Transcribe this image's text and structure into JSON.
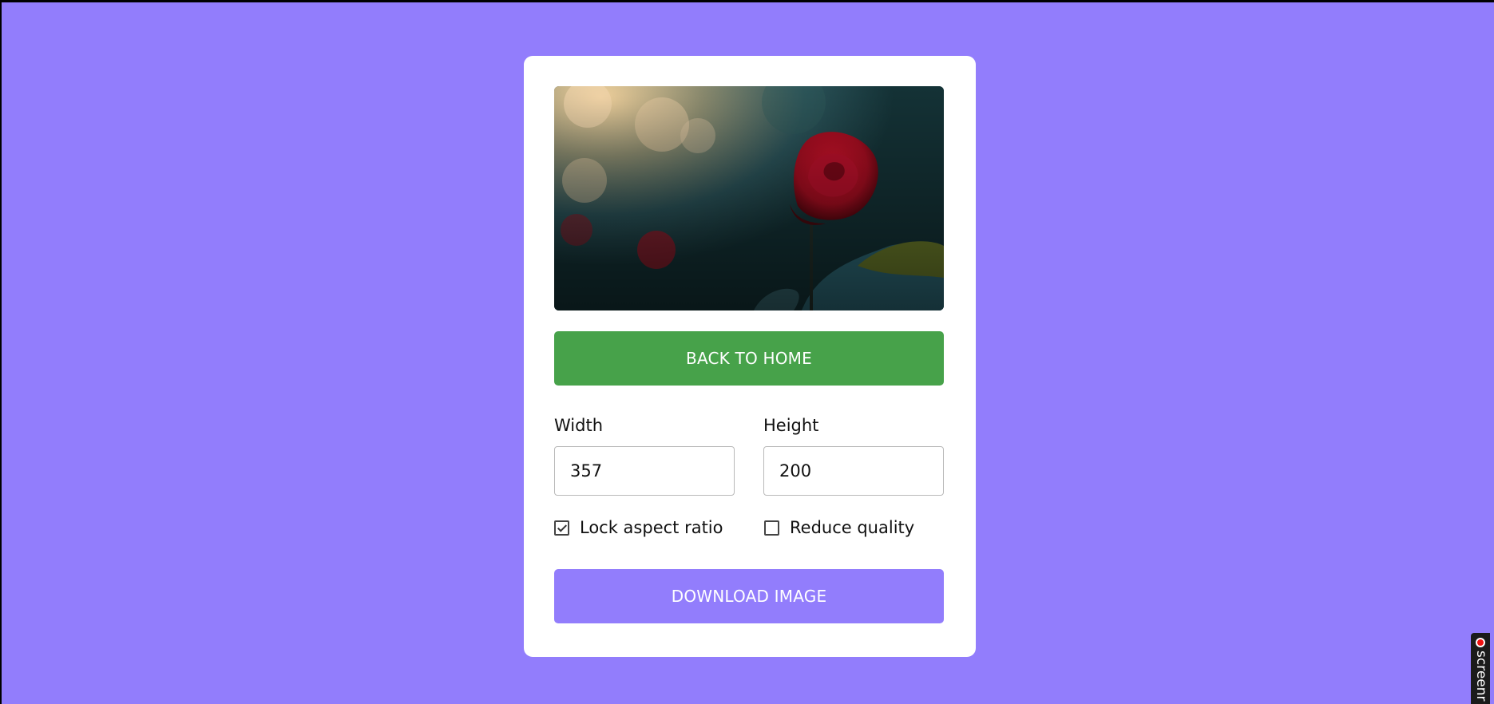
{
  "editor": {
    "preview_image": "rose-photo",
    "back_button_label": "BACK TO HOME",
    "width_label": "Width",
    "width_value": "357",
    "height_label": "Height",
    "height_value": "200",
    "lock_aspect_label": "Lock aspect ratio",
    "lock_aspect_checked": true,
    "reduce_quality_label": "Reduce quality",
    "reduce_quality_checked": false,
    "download_button_label": "DOWNLOAD IMAGE"
  },
  "recorder": {
    "label": "screenr"
  },
  "colors": {
    "page_background": "#927dfc",
    "card_background": "#ffffff",
    "home_button": "#47a24a",
    "download_button": "#927dfc"
  }
}
